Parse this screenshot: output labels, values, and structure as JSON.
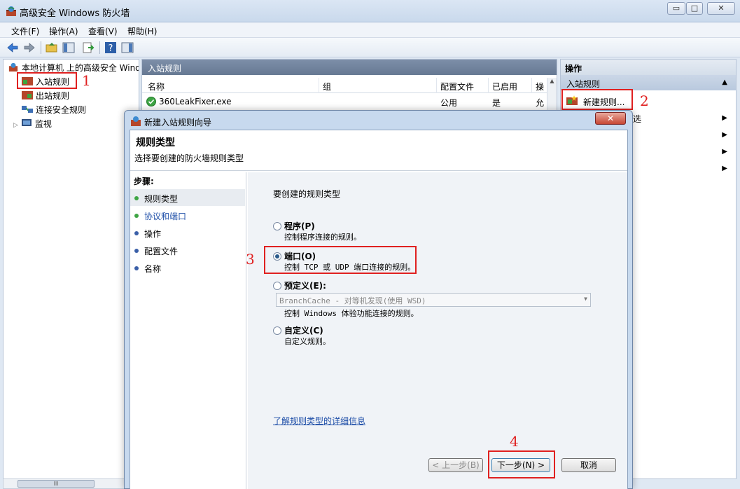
{
  "window": {
    "title": "高级安全 Windows 防火墙",
    "min_label": "▭",
    "max_label": "□",
    "close_label": "✕"
  },
  "menu": [
    "文件(F)",
    "操作(A)",
    "查看(V)",
    "帮助(H)"
  ],
  "tree": {
    "root": "本地计算机 上的高级安全 Windows",
    "items": [
      "入站规则",
      "出站规则",
      "连接安全规则",
      "监视"
    ]
  },
  "center": {
    "header": "入站规则",
    "columns": [
      "名称",
      "组",
      "配置文件",
      "已启用",
      "操"
    ],
    "rows": [
      {
        "name": "360LeakFixer.exe",
        "group": "",
        "profile": "公用",
        "enabled": "是",
        "action": "允"
      }
    ]
  },
  "actions": {
    "header": "操作",
    "section": "入站规则",
    "new_rule": "新建规则...",
    "partial_item": "选"
  },
  "dialog": {
    "title": "新建入站规则向导",
    "close_label": "✕",
    "heading": "规则类型",
    "subheading": "选择要创建的防火墙规则类型",
    "steps_title": "步骤:",
    "steps": [
      "规则类型",
      "协议和端口",
      "操作",
      "配置文件",
      "名称"
    ],
    "prompt": "要创建的规则类型",
    "options": [
      {
        "label": "程序(P)",
        "desc": "控制程序连接的规则。",
        "checked": false
      },
      {
        "label": "端口(O)",
        "desc": "控制 TCP 或 UDP 端口连接的规则。",
        "checked": true
      },
      {
        "label": "预定义(E):",
        "desc": "控制 Windows 体验功能连接的规则。",
        "checked": false
      },
      {
        "label": "自定义(C)",
        "desc": "自定义规则。",
        "checked": false
      }
    ],
    "predefined_value": "BranchCache - 对等机发现(使用 WSD)",
    "learn_more": "了解规则类型的详细信息",
    "back_button": "< 上一步(B)",
    "next_button": "下一步(N) >",
    "cancel_button": "取消"
  },
  "annotations": [
    "1",
    "2",
    "3",
    "4"
  ],
  "scrollbar_label": "III"
}
